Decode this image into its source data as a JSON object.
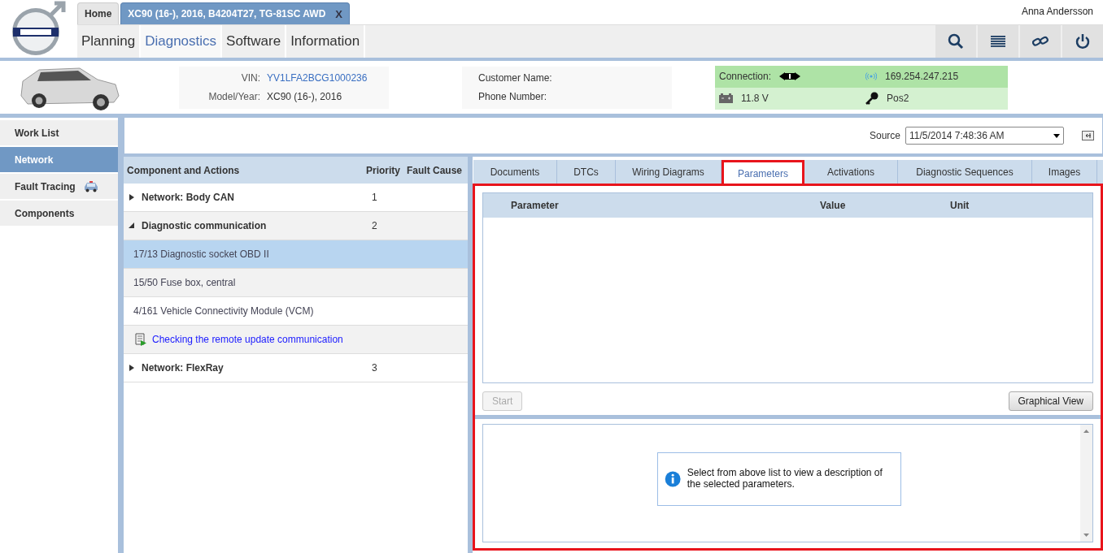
{
  "header": {
    "user_name": "Anna Andersson",
    "tabs": [
      {
        "label": "Home",
        "selected": false
      },
      {
        "label": "XC90 (16-), 2016, B4204T27, TG-81SC AWD",
        "selected": true,
        "close_label": "X"
      }
    ],
    "nav": [
      {
        "label": "Planning",
        "selected": false
      },
      {
        "label": "Diagnostics",
        "selected": true
      },
      {
        "label": "Software",
        "selected": false
      },
      {
        "label": "Information",
        "selected": false
      }
    ],
    "tools": [
      {
        "kind": "search"
      },
      {
        "kind": "menu"
      },
      {
        "kind": "link"
      },
      {
        "kind": "power"
      }
    ]
  },
  "vehicle": {
    "vin_label": "VIN:",
    "vin": "YV1LFA2BCG1000236",
    "model_label": "Model/Year:",
    "model": "XC90 (16-), 2016",
    "customer_name_label": "Customer Name:",
    "phone_label": "Phone Number:"
  },
  "connection": {
    "label": "Connection:",
    "ip": "169.254.247.215",
    "voltage": "11.8 V",
    "ignition": "Pos2"
  },
  "sidebar": {
    "items": [
      {
        "label": "Work List",
        "selected": false,
        "icon": false
      },
      {
        "label": "Network",
        "selected": true,
        "icon": false
      },
      {
        "label": "Fault Tracing",
        "selected": false,
        "icon": true
      },
      {
        "label": "Components",
        "selected": false,
        "icon": false
      }
    ]
  },
  "source": {
    "label": "Source",
    "value": "11/5/2014 7:48:36 AM"
  },
  "components": {
    "columns": [
      "Component and Actions",
      "Priority",
      "Fault Cause"
    ],
    "rows": [
      {
        "kind": "group",
        "label": "Network: Body CAN",
        "priority": "1",
        "expanded": false
      },
      {
        "kind": "group",
        "label": "Diagnostic communication",
        "priority": "2",
        "expanded": true,
        "children": [
          {
            "kind": "component",
            "label": "17/13 Diagnostic socket OBD II",
            "selected": true
          },
          {
            "kind": "component",
            "label": "15/50 Fuse box, central",
            "selected": false
          },
          {
            "kind": "component",
            "label": "4/161 Vehicle Connectivity Module (VCM)",
            "selected": false
          },
          {
            "kind": "action",
            "label": "Checking the remote update communication",
            "selected": false
          }
        ]
      },
      {
        "kind": "group",
        "label": "Network: FlexRay",
        "priority": "3",
        "expanded": false
      }
    ]
  },
  "detail_tabs": [
    {
      "label": "Documents",
      "selected": false
    },
    {
      "label": "DTCs",
      "selected": false
    },
    {
      "label": "Wiring Diagrams",
      "selected": false
    },
    {
      "label": "Parameters",
      "selected": true
    },
    {
      "label": "Activations",
      "selected": false
    },
    {
      "label": "Diagnostic Sequences",
      "selected": false
    },
    {
      "label": "Images",
      "selected": false
    }
  ],
  "parameters": {
    "columns": [
      "Parameter",
      "Value",
      "Unit"
    ],
    "buttons": [
      {
        "label": "Start",
        "disabled": true
      },
      {
        "label": "Graphical View",
        "disabled": false
      }
    ],
    "info_message": "Select from above list to view a description of the selected parameters."
  }
}
